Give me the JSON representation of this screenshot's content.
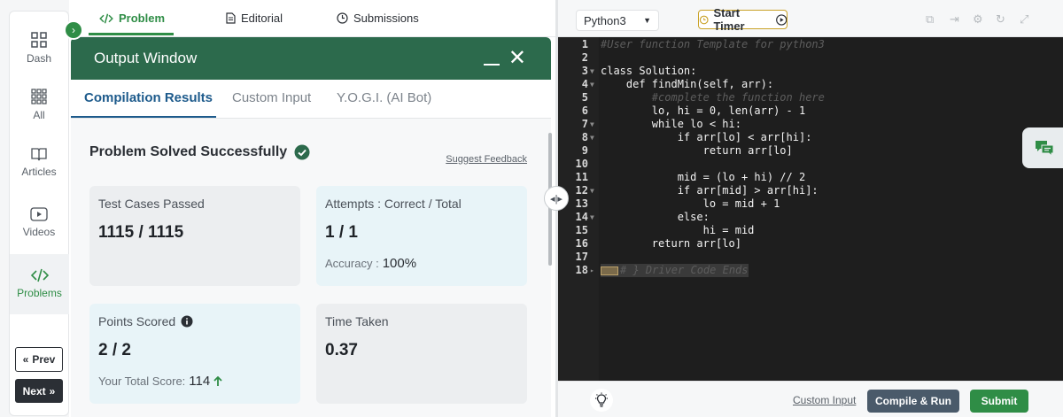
{
  "rail": {
    "items": [
      {
        "label": "Dash",
        "icon": "dashboard-icon"
      },
      {
        "label": "All",
        "icon": "grid-icon"
      },
      {
        "label": "Articles",
        "icon": "book-icon"
      },
      {
        "label": "Videos",
        "icon": "play-icon"
      },
      {
        "label": "Problems",
        "icon": "code-icon"
      }
    ],
    "prev_label": "Prev",
    "next_label": "Next"
  },
  "top_tabs": [
    {
      "label": "Problem",
      "icon": "code-icon"
    },
    {
      "label": "Editorial",
      "icon": "document-icon"
    },
    {
      "label": "Submissions",
      "icon": "clock-icon"
    }
  ],
  "output_window": {
    "title": "Output Window",
    "tabs": [
      "Compilation Results",
      "Custom Input",
      "Y.O.G.I. (AI Bot)"
    ],
    "status": "Problem Solved Successfully",
    "suggest_feedback": "Suggest Feedback",
    "cards": {
      "test_cases": {
        "title": "Test Cases Passed",
        "value": "1115 / 1115"
      },
      "attempts": {
        "title": "Attempts : Correct / Total",
        "value": "1 / 1",
        "sub_label": "Accuracy :",
        "sub_value": "100%"
      },
      "points": {
        "title": "Points Scored",
        "value": "2 / 2",
        "sub_label": "Your Total Score:",
        "sub_value": "114"
      },
      "time": {
        "title": "Time Taken",
        "value": "0.37"
      }
    }
  },
  "editor": {
    "language": "Python3",
    "timer_label": "Start Timer",
    "lines": [
      {
        "n": "1",
        "text": "#User function Template for python3"
      },
      {
        "n": "2",
        "text": ""
      },
      {
        "n": "3",
        "text": "class Solution:"
      },
      {
        "n": "4",
        "text": "    def findMin(self, arr):"
      },
      {
        "n": "5",
        "text": "        #complete the function here"
      },
      {
        "n": "6",
        "text": "        lo, hi = 0, len(arr) - 1"
      },
      {
        "n": "7",
        "text": "        while lo < hi:"
      },
      {
        "n": "8",
        "text": "            if arr[lo] < arr[hi]:"
      },
      {
        "n": "9",
        "text": "                return arr[lo]"
      },
      {
        "n": "10",
        "text": ""
      },
      {
        "n": "11",
        "text": "            mid = (lo + hi) // 2"
      },
      {
        "n": "12",
        "text": "            if arr[mid] > arr[hi]:"
      },
      {
        "n": "13",
        "text": "                lo = mid + 1"
      },
      {
        "n": "14",
        "text": "            else:"
      },
      {
        "n": "15",
        "text": "                hi = mid"
      },
      {
        "n": "16",
        "text": "        return arr[lo]"
      },
      {
        "n": "17",
        "text": ""
      },
      {
        "n": "18",
        "text": "# } Driver Code Ends"
      }
    ]
  },
  "bottom_bar": {
    "custom_input": "Custom Input",
    "compile_run": "Compile & Run",
    "submit": "Submit"
  },
  "colors": {
    "brand_green": "#2f8d46",
    "header_green": "#2c6a4c",
    "tab_blue": "#1e5b8c",
    "editor_bg": "#1e1e1e"
  }
}
